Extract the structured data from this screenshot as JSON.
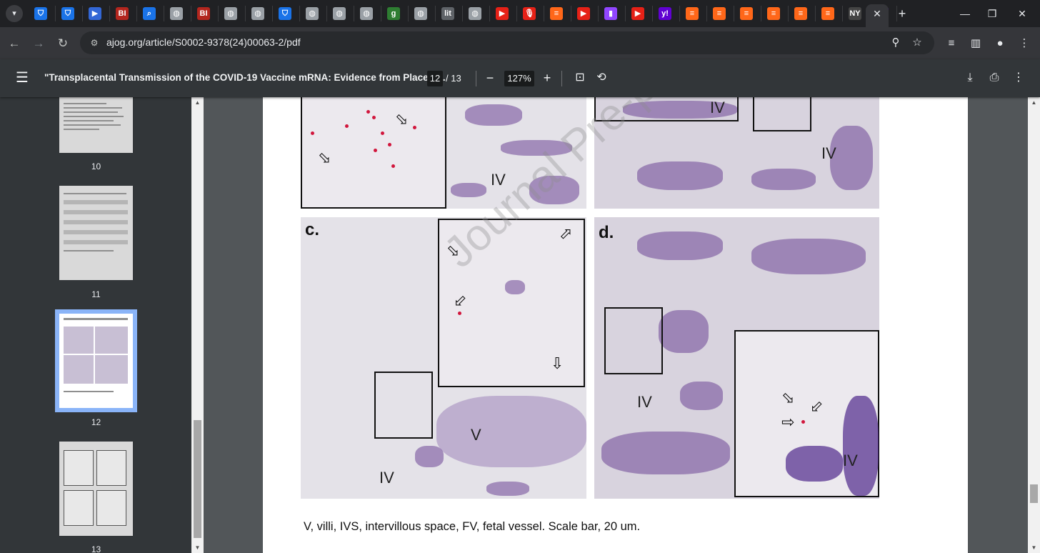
{
  "browser": {
    "tab_icons": [
      {
        "name": "tab-shield-icon",
        "glyph": "⛉",
        "color": "#1a73e8"
      },
      {
        "name": "tab-shield-icon",
        "glyph": "⛉",
        "color": "#1a73e8"
      },
      {
        "name": "tab-bookmark-icon",
        "glyph": "▶",
        "color": "#3367d6"
      },
      {
        "name": "tab-bi-icon",
        "glyph": "BI",
        "color": "#b3261e"
      },
      {
        "name": "tab-search-icon",
        "glyph": "⌕",
        "color": "#1a73e8"
      },
      {
        "name": "tab-globe-icon",
        "glyph": "◍",
        "color": "#9aa0a6"
      },
      {
        "name": "tab-bi-icon",
        "glyph": "BI",
        "color": "#b3261e"
      },
      {
        "name": "tab-globe-icon",
        "glyph": "◍",
        "color": "#9aa0a6"
      },
      {
        "name": "tab-globe-icon",
        "glyph": "◍",
        "color": "#9aa0a6"
      },
      {
        "name": "tab-shield-icon",
        "glyph": "⛉",
        "color": "#1a73e8"
      },
      {
        "name": "tab-globe-icon",
        "glyph": "◍",
        "color": "#9aa0a6"
      },
      {
        "name": "tab-globe-icon",
        "glyph": "◍",
        "color": "#9aa0a6"
      },
      {
        "name": "tab-globe-icon",
        "glyph": "◍",
        "color": "#9aa0a6"
      },
      {
        "name": "tab-g-icon",
        "glyph": "g",
        "color": "#2e7d32"
      },
      {
        "name": "tab-globe-icon",
        "glyph": "◍",
        "color": "#9aa0a6"
      },
      {
        "name": "tab-lit-icon",
        "glyph": "lit",
        "color": "#5f6368"
      },
      {
        "name": "tab-globe-icon",
        "glyph": "◍",
        "color": "#9aa0a6"
      },
      {
        "name": "tab-youtube-icon",
        "glyph": "▶",
        "color": "#e62117"
      },
      {
        "name": "tab-podcast-icon",
        "glyph": "🎙",
        "color": "#e62117"
      },
      {
        "name": "tab-substack-icon",
        "glyph": "≡",
        "color": "#ff6719"
      },
      {
        "name": "tab-youtube-icon",
        "glyph": "▶",
        "color": "#e62117"
      },
      {
        "name": "tab-twitch-icon",
        "glyph": "▮",
        "color": "#9146ff"
      },
      {
        "name": "tab-youtube-icon",
        "glyph": "▶",
        "color": "#e62117"
      },
      {
        "name": "tab-yahoo-icon",
        "glyph": "y!",
        "color": "#6001d2"
      },
      {
        "name": "tab-substack-icon",
        "glyph": "≡",
        "color": "#ff6719"
      },
      {
        "name": "tab-substack-icon",
        "glyph": "≡",
        "color": "#ff6719"
      },
      {
        "name": "tab-substack-icon",
        "glyph": "≡",
        "color": "#ff6719"
      },
      {
        "name": "tab-substack-icon",
        "glyph": "≡",
        "color": "#ff6719"
      },
      {
        "name": "tab-substack-icon",
        "glyph": "≡",
        "color": "#ff6719"
      },
      {
        "name": "tab-substack-icon",
        "glyph": "≡",
        "color": "#ff6719"
      },
      {
        "name": "tab-news-icon",
        "glyph": "NY",
        "color": "#444"
      },
      {
        "name": "tab-mail-icon",
        "glyph": "✉",
        "color": "#6001d2"
      }
    ],
    "url": "ajog.org/article/S0002-9378(24)00063-2/pdf"
  },
  "pdf": {
    "title": "\"Transplacental Transmission of the COVID-19 Vaccine mRNA: Evidence from Placent...",
    "page_current": "12",
    "page_total": "/ 13",
    "zoom": "127%",
    "thumbnails": [
      "10",
      "11",
      "12",
      "13"
    ],
    "selected_thumbnail": "12"
  },
  "figure": {
    "panel_c_label": "c.",
    "panel_d_label": "d.",
    "iv_label": "IV",
    "v_label": "V",
    "watermark": "Journal Pre-proof",
    "caption": "V, villi, IVS, intervillous space, FV, fetal vessel. Scale bar, 20 um."
  }
}
